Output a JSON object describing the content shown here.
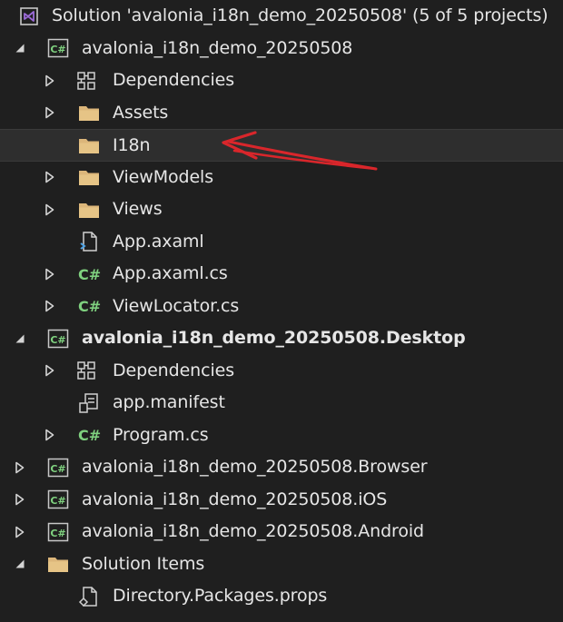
{
  "solution": {
    "label": "Solution 'avalonia_i18n_demo_20250508' (5 of 5 projects)",
    "icon": "solution-icon"
  },
  "rows": [
    {
      "label": "avalonia_i18n_demo_20250508",
      "icon": "csharp-project-icon",
      "expander": "expanded",
      "bold": false
    },
    {
      "label": "Dependencies",
      "icon": "dependencies-icon",
      "expander": "collapsed",
      "bold": false
    },
    {
      "label": "Assets",
      "icon": "folder-icon",
      "expander": "collapsed",
      "bold": false
    },
    {
      "label": "I18n",
      "icon": "folder-icon",
      "expander": "none",
      "bold": false,
      "selected": true
    },
    {
      "label": "ViewModels",
      "icon": "folder-icon",
      "expander": "collapsed",
      "bold": false
    },
    {
      "label": "Views",
      "icon": "folder-icon",
      "expander": "collapsed",
      "bold": false
    },
    {
      "label": "App.axaml",
      "icon": "xaml-file-icon",
      "expander": "none",
      "bold": false
    },
    {
      "label": "App.axaml.cs",
      "icon": "csharp-file-icon",
      "expander": "collapsed",
      "bold": false
    },
    {
      "label": "ViewLocator.cs",
      "icon": "csharp-file-icon",
      "expander": "collapsed",
      "bold": false
    },
    {
      "label": "avalonia_i18n_demo_20250508.Desktop",
      "icon": "csharp-project-icon",
      "expander": "expanded",
      "bold": true
    },
    {
      "label": "Dependencies",
      "icon": "dependencies-icon",
      "expander": "collapsed",
      "bold": false
    },
    {
      "label": "app.manifest",
      "icon": "manifest-file-icon",
      "expander": "none",
      "bold": false
    },
    {
      "label": "Program.cs",
      "icon": "csharp-file-icon",
      "expander": "collapsed",
      "bold": false
    },
    {
      "label": "avalonia_i18n_demo_20250508.Browser",
      "icon": "csharp-project-icon",
      "expander": "collapsed",
      "bold": false
    },
    {
      "label": "avalonia_i18n_demo_20250508.iOS",
      "icon": "csharp-project-icon",
      "expander": "collapsed",
      "bold": false
    },
    {
      "label": "avalonia_i18n_demo_20250508.Android",
      "icon": "csharp-project-icon",
      "expander": "collapsed",
      "bold": false
    },
    {
      "label": "Solution Items",
      "icon": "solution-folder-icon",
      "expander": "expanded",
      "bold": false
    },
    {
      "label": "Directory.Packages.props",
      "icon": "props-file-icon",
      "expander": "none",
      "bold": false
    }
  ],
  "colors": {
    "background": "#1f1f1f",
    "text": "#e6e6e6",
    "selected_row": "#2e2e2e",
    "folder": "#dcb67a",
    "csharp": "#7fd17f",
    "solution": "#9b6ad6",
    "annotation_arrow": "#d9262b"
  }
}
